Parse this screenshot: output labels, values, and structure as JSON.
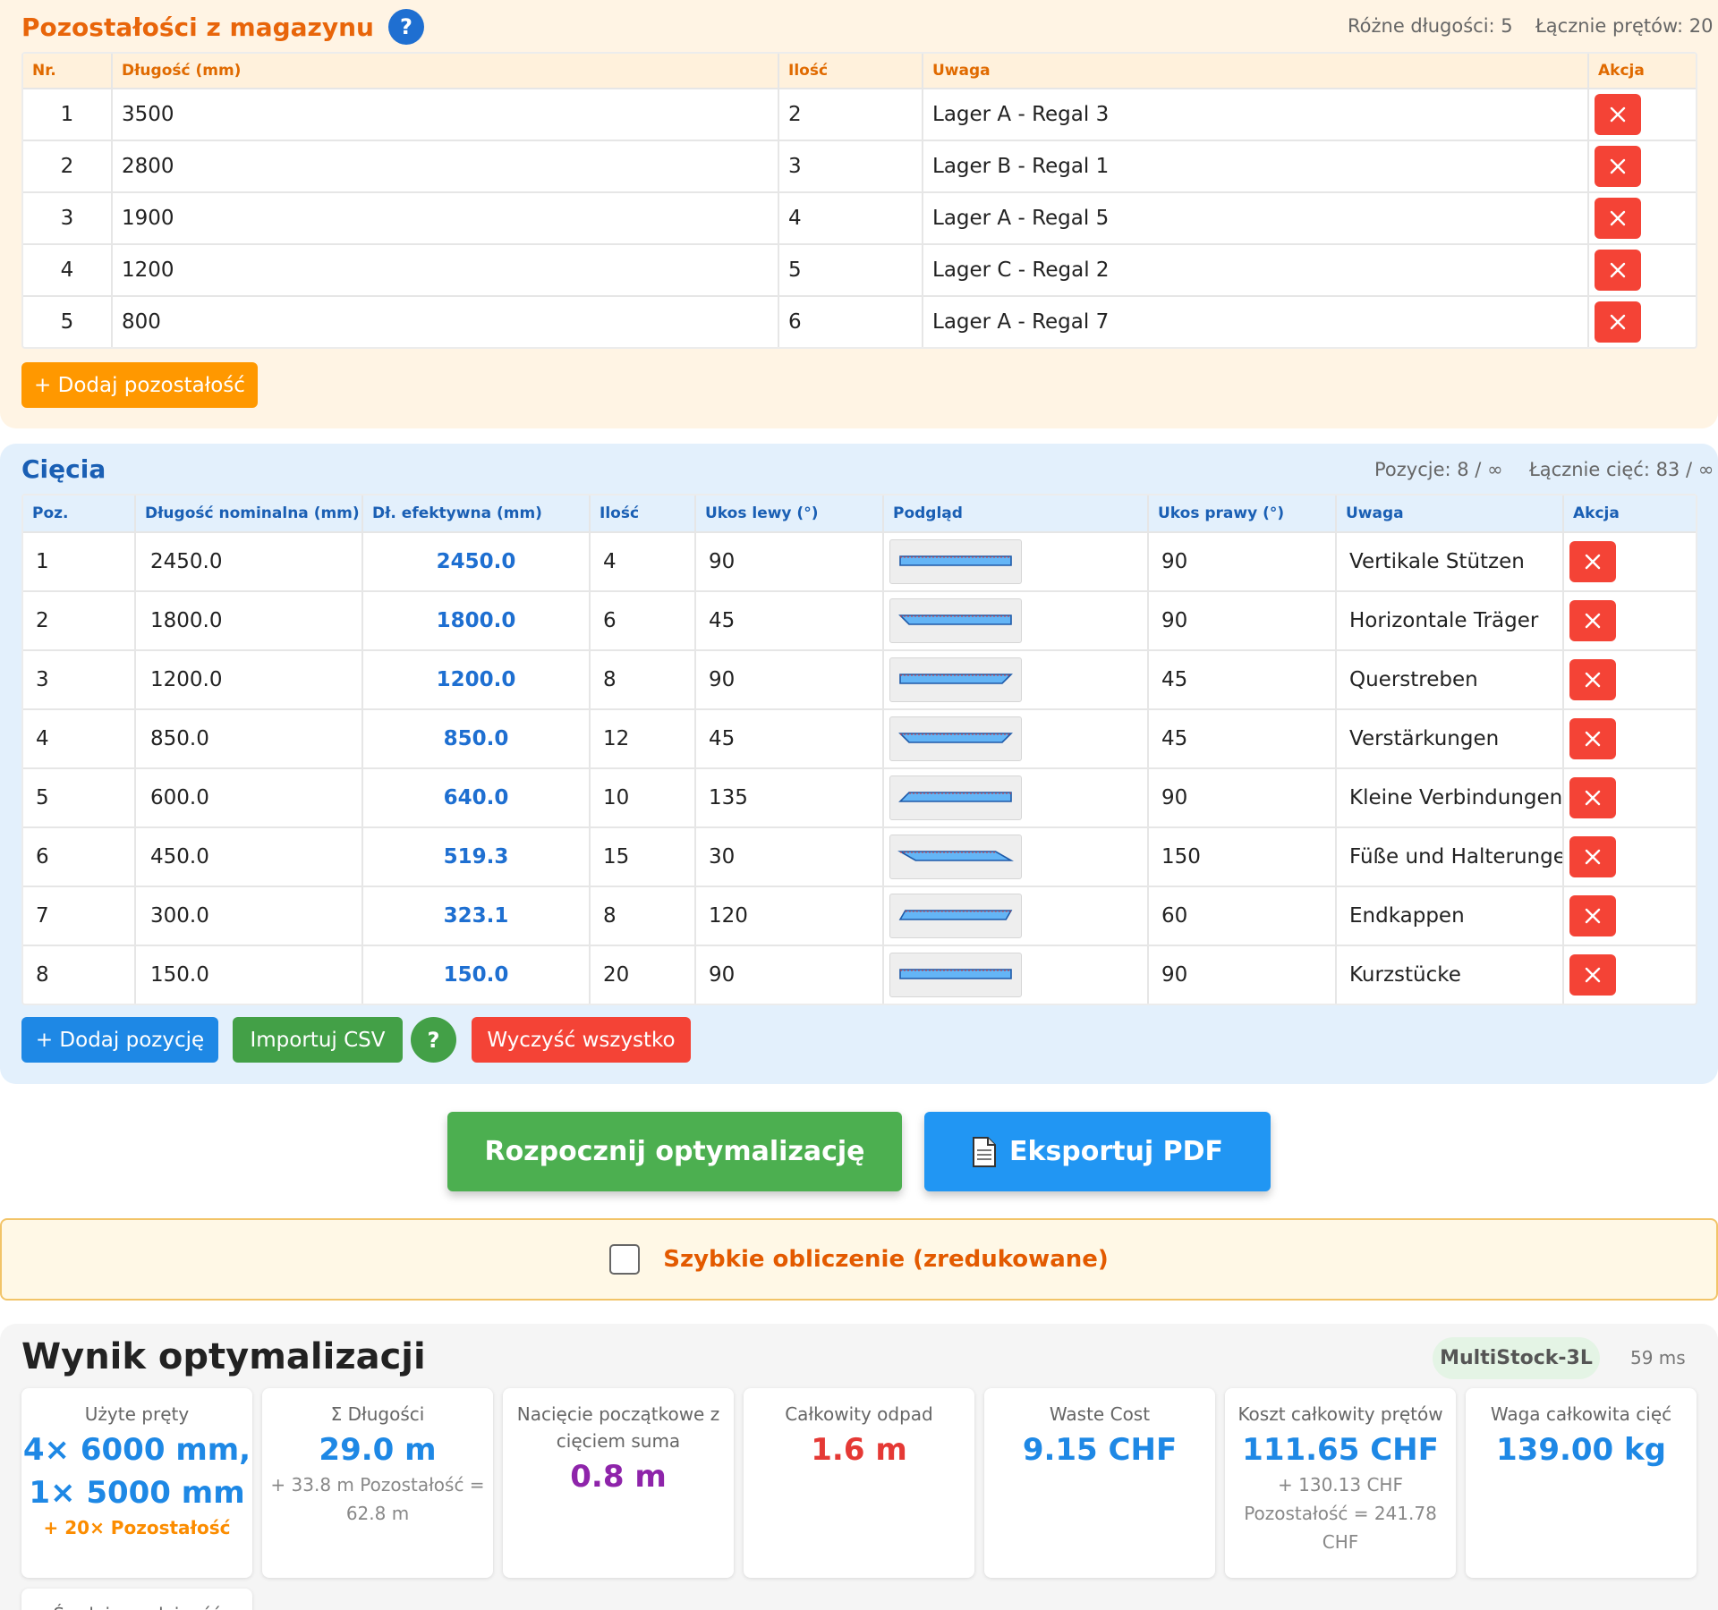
{
  "stock": {
    "title": "Pozostałości z magazynu",
    "help": "?",
    "different_lengths": "Różne długości: 5",
    "total_bars": "Łącznie prętów: 20",
    "columns": [
      "Nr.",
      "Długość (mm)",
      "Ilość",
      "Uwaga",
      "Akcja"
    ],
    "rows": [
      {
        "nr": "1",
        "length": "3500",
        "qty": "2",
        "note": "Lager A - Regal 3"
      },
      {
        "nr": "2",
        "length": "2800",
        "qty": "3",
        "note": "Lager B - Regal 1"
      },
      {
        "nr": "3",
        "length": "1900",
        "qty": "4",
        "note": "Lager A - Regal 5"
      },
      {
        "nr": "4",
        "length": "1200",
        "qty": "5",
        "note": "Lager C - Regal 2"
      },
      {
        "nr": "5",
        "length": "800",
        "qty": "6",
        "note": "Lager A - Regal 7"
      }
    ],
    "add_button": "+ Dodaj pozostałość"
  },
  "cuts": {
    "title": "Cięcia",
    "positions": "Pozycje: 8 / ∞",
    "total_cuts": "Łącznie cięć: 83 / ∞",
    "columns": [
      "Poz.",
      "Długość nominalna (mm)",
      "Dł. efektywna (mm)",
      "Ilość",
      "Ukos lewy (°)",
      "Podgląd",
      "Ukos prawy (°)",
      "Uwaga",
      "Akcja"
    ],
    "rows": [
      {
        "pos": "1",
        "nominal": "2450.0",
        "effective": "2450.0",
        "qty": "4",
        "left": "90",
        "right": "90",
        "note": "Vertikale Stützen"
      },
      {
        "pos": "2",
        "nominal": "1800.0",
        "effective": "1800.0",
        "qty": "6",
        "left": "45",
        "right": "90",
        "note": "Horizontale Träger"
      },
      {
        "pos": "3",
        "nominal": "1200.0",
        "effective": "1200.0",
        "qty": "8",
        "left": "90",
        "right": "45",
        "note": "Querstreben"
      },
      {
        "pos": "4",
        "nominal": "850.0",
        "effective": "850.0",
        "qty": "12",
        "left": "45",
        "right": "45",
        "note": "Verstärkungen"
      },
      {
        "pos": "5",
        "nominal": "600.0",
        "effective": "640.0",
        "qty": "10",
        "left": "135",
        "right": "90",
        "note": "Kleine Verbindungen"
      },
      {
        "pos": "6",
        "nominal": "450.0",
        "effective": "519.3",
        "qty": "15",
        "left": "30",
        "right": "150",
        "note": "Füße und Halterungen"
      },
      {
        "pos": "7",
        "nominal": "300.0",
        "effective": "323.1",
        "qty": "8",
        "left": "120",
        "right": "60",
        "note": "Endkappen"
      },
      {
        "pos": "8",
        "nominal": "150.0",
        "effective": "150.0",
        "qty": "20",
        "left": "90",
        "right": "90",
        "note": "Kurzstücke"
      }
    ],
    "add_button": "+ Dodaj pozycję",
    "import_button": "Importuj CSV",
    "help": "?",
    "clear_button": "Wyczyść wszystko"
  },
  "actions": {
    "optimize": "Rozpocznij optymalizację",
    "export": "Eksportuj PDF"
  },
  "quick": {
    "label": "Szybkie obliczenie (zredukowane)",
    "checked": false
  },
  "result": {
    "title": "Wynik optymalizacji",
    "algorithm": "MultiStock-3L",
    "time": "59 ms",
    "cards": [
      {
        "title": "Użyte pręty",
        "value_line1": "4× 6000 mm,",
        "value_line2": "1× 5000 mm",
        "sub": "+ 20× Pozostałość"
      },
      {
        "title": "Σ Długości",
        "value": "29.0 m",
        "sub": "+ 33.8 m Pozostałość = 62.8 m"
      },
      {
        "title": "Nacięcie początkowe z cięciem suma",
        "value": "0.8 m"
      },
      {
        "title": "Całkowity odpad",
        "value": "1.6 m"
      },
      {
        "title": "Waste Cost",
        "value": "9.15 CHF"
      },
      {
        "title": "Koszt całkowity prętów",
        "value": "111.65 CHF",
        "sub": "+ 130.13 CHF Pozostałość = 241.78 CHF"
      },
      {
        "title": "Waga całkowita cięć",
        "value": "139.00 kg"
      },
      {
        "title": "Średnia wydajność"
      }
    ]
  },
  "colors": {
    "stock_accent": "#e8650a",
    "cuts_accent": "#1a5fb4",
    "danger": "#f44336",
    "success": "#4caf50",
    "primary": "#2196f3"
  }
}
